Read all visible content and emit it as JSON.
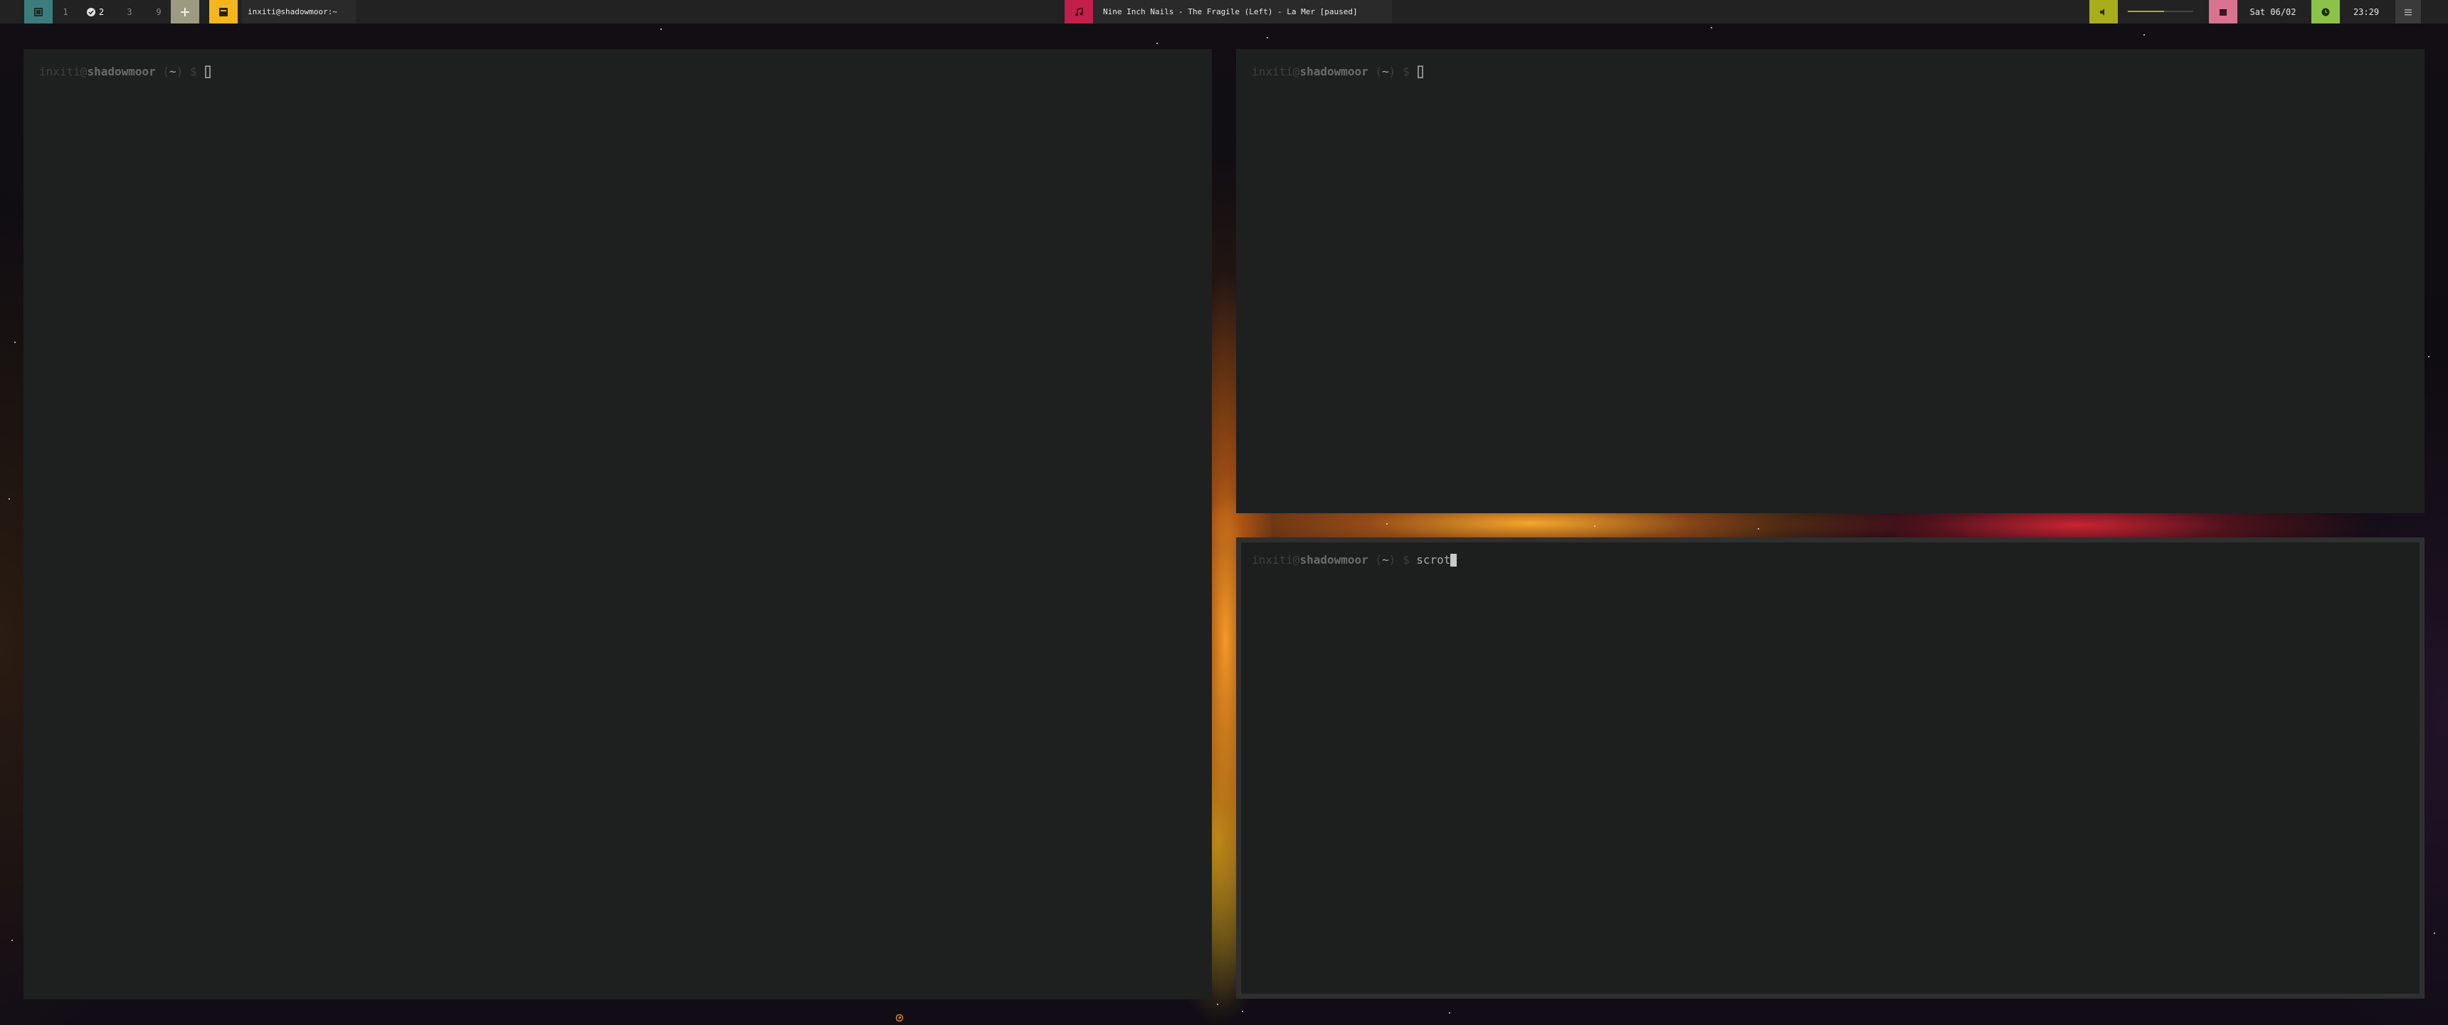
{
  "topbar": {
    "workspaces": [
      {
        "label": "1",
        "active": false
      },
      {
        "label": "2",
        "active": true,
        "icon": "check-icon"
      },
      {
        "label": "3",
        "active": false
      },
      {
        "label": "9",
        "active": false
      }
    ],
    "add_workspace_icon": "plus-icon",
    "window_title": "inxiti@shadowmoor:~",
    "now_playing": "Nine Inch Nails - The Fragile (Left) - La Mer [paused]",
    "volume_level": 0.55,
    "date": "Sat 06/02",
    "time": "23:29",
    "colors": {
      "menu": "#3a7d7c",
      "terminal_icon": "#f3b61c",
      "music": "#c41e4a",
      "volume": "#a8ad1c",
      "calendar": "#d87390",
      "clock": "#8bc34a",
      "add": "#9c9a80"
    }
  },
  "terminals": [
    {
      "name": "left",
      "user": "inxiti",
      "host": "shadowmoor",
      "dir": "~",
      "symbol": "$",
      "command": ""
    },
    {
      "name": "top-right",
      "user": "inxiti",
      "host": "shadowmoor",
      "dir": "~",
      "symbol": "$",
      "command": ""
    },
    {
      "name": "bottom-right",
      "user": "inxiti",
      "host": "shadowmoor",
      "dir": "~",
      "symbol": "$",
      "command": "scrot"
    }
  ]
}
